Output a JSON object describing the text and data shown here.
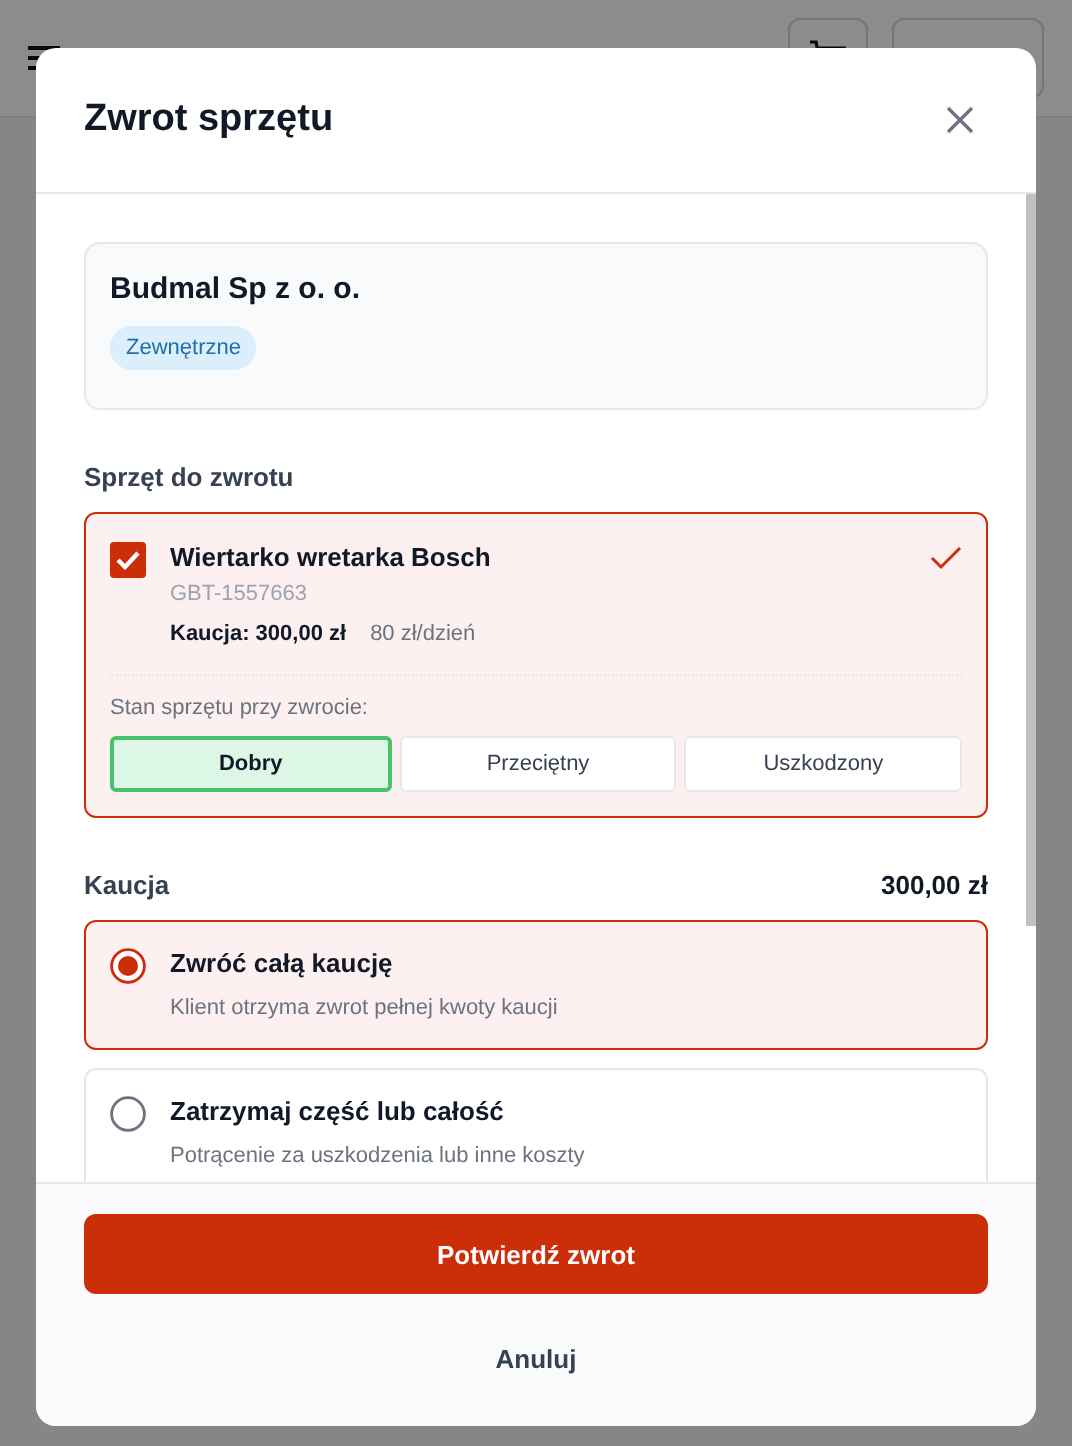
{
  "dialog": {
    "title": "Zwrot sprzętu",
    "customer": {
      "name": "Budmal Sp z o. o.",
      "badge": "Zewnętrzne"
    },
    "section_title": "Sprzęt do zwrotu",
    "items": [
      {
        "name": "Wiertarko wretarka Bosch",
        "code": "GBT-1557663",
        "deposit": "Kaucja: 300,00 zł",
        "rate": "80 zł/dzień",
        "checked": true,
        "condition_label": "Stan sprzętu przy zwrocie:",
        "conditions": [
          {
            "label": "Dobry",
            "selected": true
          },
          {
            "label": "Przeciętny",
            "selected": false
          },
          {
            "label": "Uszkodzony",
            "selected": false
          }
        ]
      }
    ],
    "deposit": {
      "label": "Kaucja",
      "amount": "300,00 zł",
      "options": [
        {
          "title": "Zwróć całą kaucję",
          "description": "Klient otrzyma zwrot pełnej kwoty kaucji",
          "selected": true
        },
        {
          "title": "Zatrzymaj część lub całość",
          "description": "Potrącenie za uszkodzenia lub inne koszty",
          "selected": false
        }
      ]
    },
    "confirm_button": "Potwierdź zwrot",
    "cancel_button": "Anuluj"
  }
}
